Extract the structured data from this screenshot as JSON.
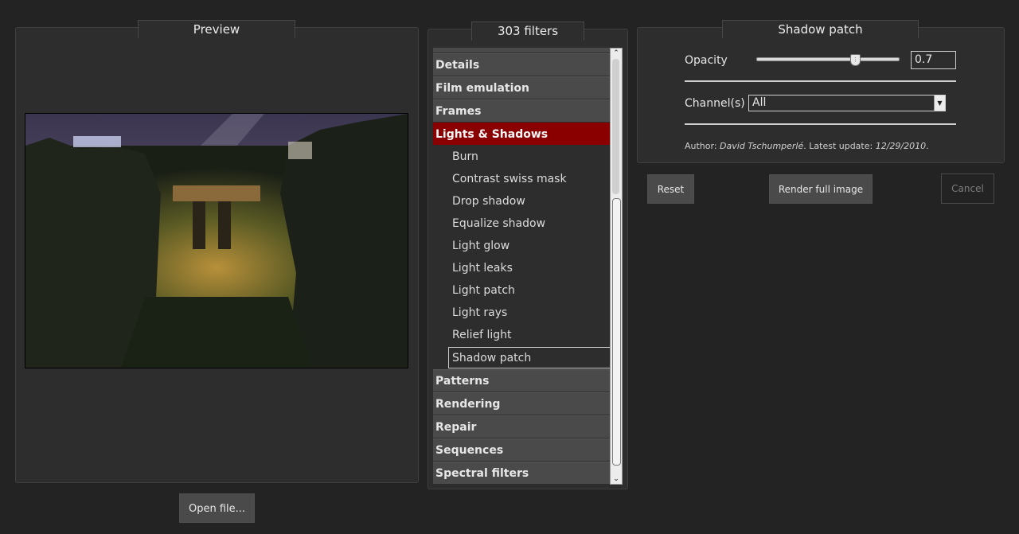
{
  "preview": {
    "title": "Preview",
    "open_file_label": "Open file..."
  },
  "filters": {
    "count_label": "303 filters",
    "rows": [
      {
        "kind": "cat",
        "label": "Details"
      },
      {
        "kind": "cat",
        "label": "Film emulation"
      },
      {
        "kind": "cat",
        "label": "Frames"
      },
      {
        "kind": "cat-selected",
        "label": "Lights & Shadows"
      },
      {
        "kind": "item",
        "label": "Burn"
      },
      {
        "kind": "item",
        "label": "Contrast swiss mask"
      },
      {
        "kind": "item",
        "label": "Drop shadow"
      },
      {
        "kind": "item",
        "label": "Equalize shadow"
      },
      {
        "kind": "item",
        "label": "Light glow"
      },
      {
        "kind": "item",
        "label": "Light leaks"
      },
      {
        "kind": "item",
        "label": "Light patch"
      },
      {
        "kind": "item",
        "label": "Light rays"
      },
      {
        "kind": "item",
        "label": "Relief light"
      },
      {
        "kind": "item-selected",
        "label": "Shadow patch"
      },
      {
        "kind": "cat",
        "label": "Patterns"
      },
      {
        "kind": "cat",
        "label": "Rendering"
      },
      {
        "kind": "cat",
        "label": "Repair"
      },
      {
        "kind": "cat",
        "label": "Sequences"
      },
      {
        "kind": "cat",
        "label": "Spectral filters"
      }
    ],
    "selected_color": "#8a0000"
  },
  "settings": {
    "title": "Shadow patch",
    "opacity_label": "Opacity",
    "opacity_value": "0.7",
    "opacity_fraction": 0.7,
    "channel_label": "Channel(s)",
    "channel_value": "All",
    "author_prefix": "Author: ",
    "author_name": "David Tschumperlé",
    "update_prefix": ". Latest update: ",
    "update_date": "12/29/2010",
    "update_suffix": "."
  },
  "buttons": {
    "reset": "Reset",
    "render": "Render full image",
    "cancel": "Cancel"
  },
  "icons": {
    "scroll_up": "chevron-up-icon",
    "scroll_down": "chevron-down-icon",
    "dropdown": "dropdown-arrow-icon"
  }
}
